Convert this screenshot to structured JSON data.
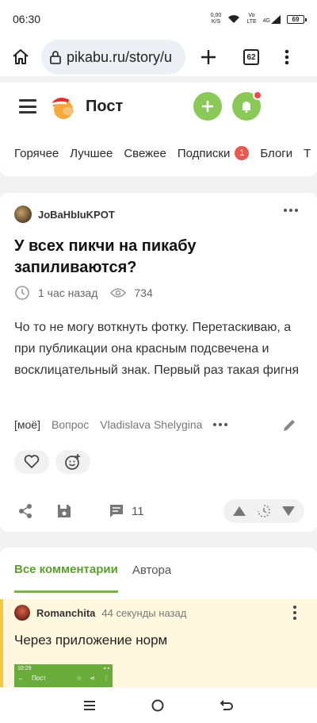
{
  "status_bar": {
    "time": "06:30",
    "net_speed_value": "0,00",
    "net_speed_unit": "K/S",
    "network_top": "Vo",
    "network_bottom": "LTE",
    "cell_type": "4G",
    "battery": "69"
  },
  "browser": {
    "url": "pikabu.ru/story/u",
    "tabs_count": "62"
  },
  "site_header": {
    "title": "Пост"
  },
  "categories": {
    "items": [
      "Горячее",
      "Лучшее",
      "Свежее",
      "Подписки",
      "Блоги",
      "Т"
    ],
    "subscriptions_badge": "1"
  },
  "story": {
    "author": "JoBaHbIuKPOT",
    "title": "У всех пикчи на пикабу запиливаются?",
    "time_ago": "1 час назад",
    "views": "734",
    "body": "Чо то не могу воткнуть фотку. Перетаскиваю, а при публикации она красным подсвечена и восклицательный знак. Первый раз такая фигня",
    "tags": [
      "[моё]",
      "Вопрос",
      "Vladislava Shelygina"
    ],
    "comments_count": "11"
  },
  "comments": {
    "tabs": [
      "Все комментарии",
      "Автора"
    ],
    "first": {
      "author": "Romanchita",
      "time_ago": "44 секунды назад",
      "text": "Через приложение норм",
      "image_time": "10:29",
      "image_title": "Пост"
    }
  },
  "colors": {
    "accent_green": "#8ac858",
    "badge_red": "#e85a4f",
    "comment_highlight": "#fff8de"
  }
}
